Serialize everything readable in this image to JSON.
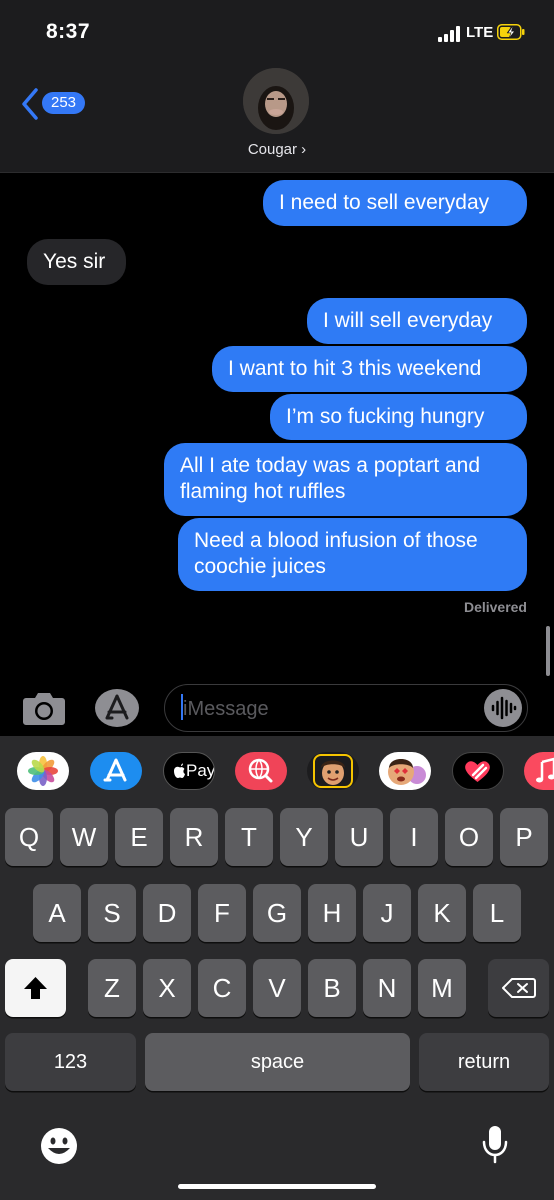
{
  "status": {
    "time": "8:37",
    "network": "LTE"
  },
  "header": {
    "back_count": "253",
    "contact_name": "Cougar ›"
  },
  "messages": [
    {
      "from": "me",
      "text": "I need to sell everyday"
    },
    {
      "from": "them",
      "text": "Yes sir"
    },
    {
      "from": "me",
      "text": "I will sell everyday"
    },
    {
      "from": "me",
      "text": "I want to hit 3 this weekend"
    },
    {
      "from": "me",
      "text": "I’m so fucking hungry"
    },
    {
      "from": "me",
      "text": "All I ate today was a poptart and\nflaming hot ruffles"
    },
    {
      "from": "me",
      "text": "Need a blood infusion of those\ncoochie juices"
    }
  ],
  "delivered": "Delivered",
  "input": {
    "placeholder": "iMessage",
    "value": ""
  },
  "app_strip": [
    {
      "icon": "photos-icon"
    },
    {
      "icon": "app-store-icon"
    },
    {
      "icon": "apple-pay-icon",
      "label": "Pay"
    },
    {
      "icon": "web-search-icon"
    },
    {
      "icon": "memoji-icon"
    },
    {
      "icon": "memoji-stickers-icon"
    },
    {
      "icon": "digital-touch-icon"
    },
    {
      "icon": "music-icon"
    }
  ],
  "keyboard": {
    "row1": [
      "Q",
      "W",
      "E",
      "R",
      "T",
      "Y",
      "U",
      "I",
      "O",
      "P"
    ],
    "row2": [
      "A",
      "S",
      "D",
      "F",
      "G",
      "H",
      "J",
      "K",
      "L"
    ],
    "row3": [
      "Z",
      "X",
      "C",
      "V",
      "B",
      "N",
      "M"
    ],
    "numbers_label": "123",
    "space_label": "space",
    "return_label": "return"
  },
  "colors": {
    "outgoing_bubble": "#2f7bf5",
    "incoming_bubble": "#262629",
    "accent": "#3478f6"
  }
}
